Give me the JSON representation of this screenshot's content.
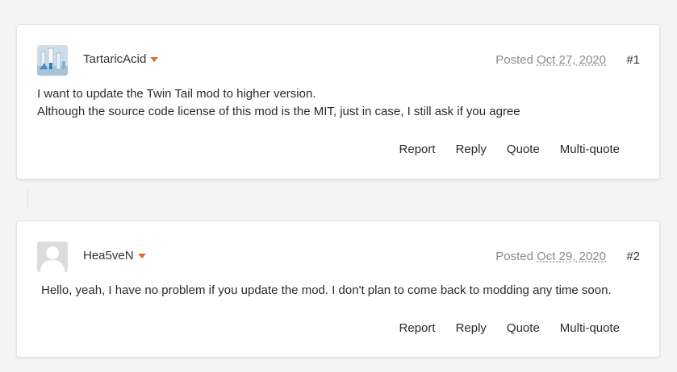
{
  "posts": [
    {
      "author": "TartaricAcid",
      "posted_label": "Posted",
      "date": "Oct 27, 2020",
      "number": "#1",
      "lines": [
        "I want to update the Twin Tail mod to higher version.",
        "Although the source code license of this mod is the MIT, just in case, I still ask if you agree"
      ],
      "actions": [
        "Report",
        "Reply",
        "Quote",
        "Multi-quote"
      ]
    },
    {
      "author": "Hea5veN",
      "posted_label": "Posted",
      "date": "Oct 29, 2020",
      "number": "#2",
      "lines": [
        "Hello, yeah, I have no problem if you update the mod. I don't plan to come back to modding any time soon."
      ],
      "actions": [
        "Report",
        "Reply",
        "Quote",
        "Multi-quote"
      ]
    }
  ],
  "colors": {
    "accent": "#e06a2c",
    "background": "#f4f4f4",
    "card": "#ffffff"
  }
}
